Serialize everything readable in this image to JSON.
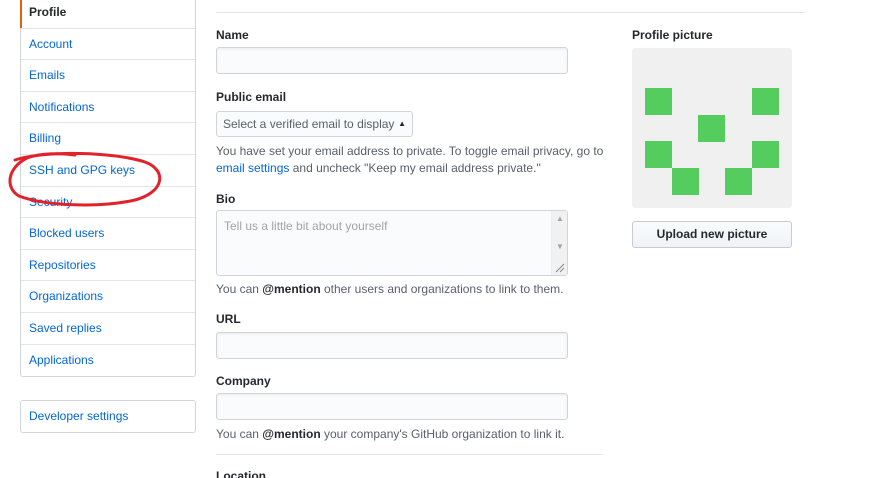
{
  "sidebar": {
    "items": [
      {
        "label": "Profile"
      },
      {
        "label": "Account"
      },
      {
        "label": "Emails"
      },
      {
        "label": "Notifications"
      },
      {
        "label": "Billing"
      },
      {
        "label": "SSH and GPG keys"
      },
      {
        "label": "Security"
      },
      {
        "label": "Blocked users"
      },
      {
        "label": "Repositories"
      },
      {
        "label": "Organizations"
      },
      {
        "label": "Saved replies"
      },
      {
        "label": "Applications"
      }
    ],
    "developer_settings": "Developer settings"
  },
  "form": {
    "name_label": "Name",
    "public_email_label": "Public email",
    "public_email_select": "Select a verified email to display",
    "email_note_pre": "You have set your email address to private. To toggle email privacy, go to",
    "email_note_link": "email settings",
    "email_note_post": "and uncheck \"Keep my email address private.\"",
    "bio_label": "Bio",
    "bio_placeholder": "Tell us a little bit about yourself",
    "bio_note_pre": "You can",
    "bio_note_mention": "@mention",
    "bio_note_post": "other users and organizations to link to them.",
    "url_label": "URL",
    "company_label": "Company",
    "company_note_pre": "You can",
    "company_note_mention": "@mention",
    "company_note_post": "your company's GitHub organization to link it.",
    "location_label": "Location"
  },
  "profile_picture": {
    "label": "Profile picture",
    "upload_button": "Upload new picture"
  },
  "colors": {
    "link": "#0366d6",
    "selected_accent": "#e36209",
    "identicon": "#55cc5e",
    "annotation": "#e0222a"
  }
}
